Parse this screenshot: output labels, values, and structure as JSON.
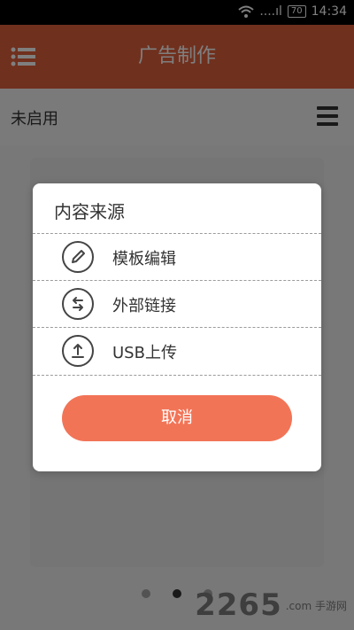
{
  "status_bar": {
    "time": "14:34",
    "battery": "70",
    "signal_text": "....ıl"
  },
  "app_bar": {
    "title": "广告制作"
  },
  "subheader": {
    "label": "未启用"
  },
  "dialog": {
    "title": "内容来源",
    "options": [
      {
        "label": "模板编辑",
        "icon": "pencil-icon"
      },
      {
        "label": "外部链接",
        "icon": "swap-arrows-icon"
      },
      {
        "label": "USB上传",
        "icon": "upload-icon"
      }
    ],
    "cancel_label": "取消"
  },
  "page_indicator": {
    "count": 3,
    "active_index": 1
  },
  "watermark": {
    "number": "2265",
    "text": ".com 手游网"
  },
  "colors": {
    "accent": "#e0613d",
    "cancel": "#f27457",
    "text": "#333333"
  }
}
